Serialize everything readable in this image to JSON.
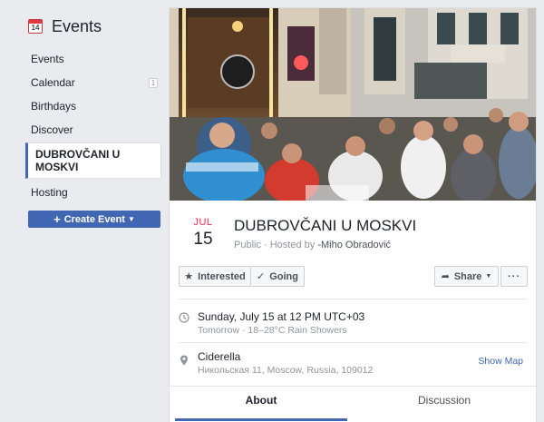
{
  "sidebar": {
    "title": "Events",
    "calendar_icon_day": "14",
    "items": [
      {
        "label": "Events"
      },
      {
        "label": "Calendar",
        "count": "1"
      },
      {
        "label": "Birthdays"
      },
      {
        "label": "Discover"
      },
      {
        "label": "DUBROVČANI U MOSKVI"
      },
      {
        "label": "Hosting"
      }
    ],
    "create_button": "Create Event"
  },
  "event": {
    "month": "JUL",
    "day": "15",
    "title": "DUBROVČANI U MOSKVI",
    "privacy": "Public · Hosted by ",
    "host": "-Miho Obradović",
    "actions": {
      "interested": "Interested",
      "going": "Going",
      "share": "Share",
      "more": "···"
    },
    "time": {
      "main": "Sunday, July 15 at 12 PM UTC+03",
      "sub": "Tomorrow · 18–28°C Rain Showers"
    },
    "location": {
      "name": "Ciderella",
      "address": "Никольская 11, Moscow, Russia, 109012",
      "map_link": "Show Map"
    }
  },
  "tabs": [
    {
      "label": "About"
    },
    {
      "label": "Discussion"
    }
  ],
  "colors": {
    "accent": "#4267b2",
    "month": "#f02849",
    "background": "#e9ebee"
  },
  "icons": [
    "calendar-icon",
    "star-icon",
    "check-icon",
    "share-arrow-icon",
    "clock-icon",
    "location-pin-icon"
  ]
}
